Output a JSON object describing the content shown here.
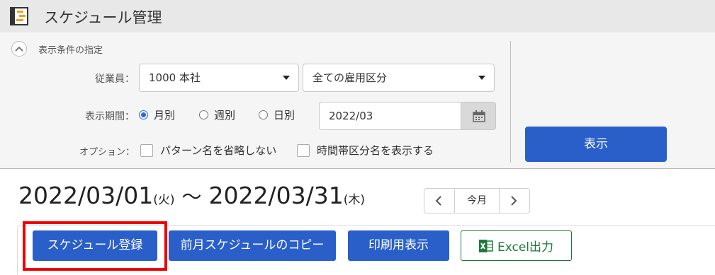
{
  "app": {
    "title": "スケジュール管理",
    "icon": "schedule-app-icon"
  },
  "filter": {
    "section_label": "表示条件の指定",
    "employee_label": "従業員：",
    "employee_value": "1000 本社",
    "employment_type_value": "全ての雇用区分",
    "period_label": "表示期間：",
    "period_options": [
      {
        "label": "月別",
        "selected": true
      },
      {
        "label": "週別",
        "selected": false
      },
      {
        "label": "日別",
        "selected": false
      }
    ],
    "date_value": "2022/03",
    "options_label": "オプション：",
    "option_checks": [
      {
        "label": "パターン名を省略しない",
        "checked": false
      },
      {
        "label": "時間帯区分名を表示する",
        "checked": false
      }
    ],
    "show_button": "表示"
  },
  "range": {
    "start_date": "2022/03/01",
    "start_day": "(火)",
    "separator": "〜",
    "end_date": "2022/03/31",
    "end_day": "(木)"
  },
  "navigation": {
    "today": "今月"
  },
  "actions": {
    "register": "スケジュール登録",
    "copy_prev": "前月スケジュールのコピー",
    "print": "印刷用表示",
    "excel": "Excel出力"
  },
  "colors": {
    "primary": "#2a5fc9",
    "excel": "#1d7a3a",
    "highlight": "#ee0000"
  }
}
